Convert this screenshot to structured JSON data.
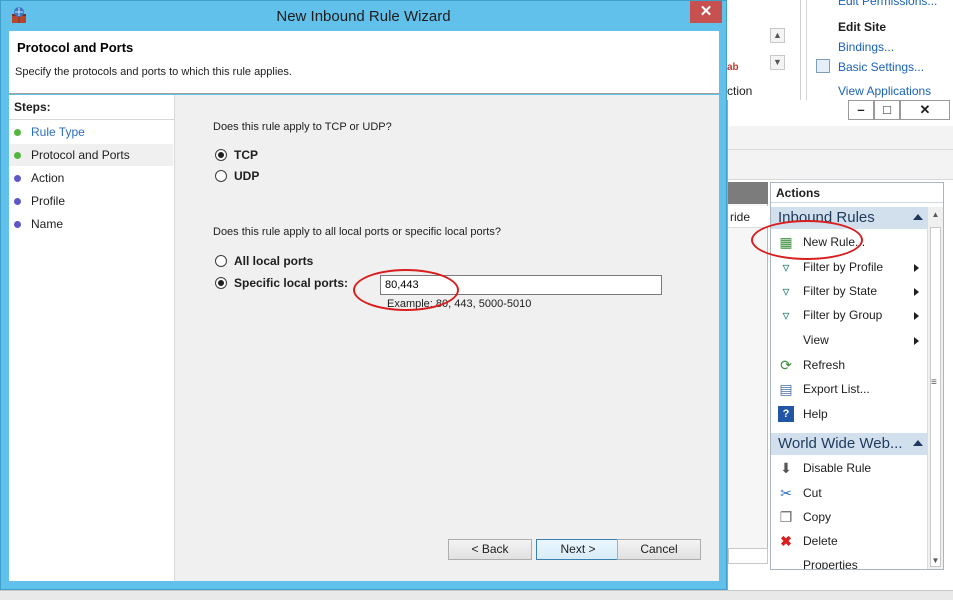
{
  "background": {
    "iis": {
      "links": [
        "Edit Permissions...",
        "Bindings...",
        "Basic Settings...",
        "View Applications"
      ],
      "edit_site_heading": "Edit Site",
      "clipped_texts": [
        "ab",
        "ction"
      ]
    },
    "firewall_console": {
      "window_controls": [
        "–",
        "□",
        "✕"
      ],
      "mid_column_partial": "ride",
      "actions_title": "Actions",
      "sections": [
        {
          "title": "Inbound Rules",
          "items": [
            {
              "label": "New Rule...",
              "icon": "new-rule-icon",
              "submenu": false
            },
            {
              "label": "Filter by Profile",
              "icon": "filter-icon",
              "submenu": true
            },
            {
              "label": "Filter by State",
              "icon": "filter-icon",
              "submenu": true
            },
            {
              "label": "Filter by Group",
              "icon": "filter-icon",
              "submenu": true
            },
            {
              "label": "View",
              "icon": "",
              "submenu": true
            },
            {
              "label": "Refresh",
              "icon": "refresh-icon",
              "submenu": false
            },
            {
              "label": "Export List...",
              "icon": "export-icon",
              "submenu": false
            },
            {
              "label": "Help",
              "icon": "help-icon",
              "submenu": false
            }
          ]
        },
        {
          "title": "World Wide Web...",
          "items": [
            {
              "label": "Disable Rule",
              "icon": "disable-icon",
              "submenu": false
            },
            {
              "label": "Cut",
              "icon": "cut-icon",
              "submenu": false
            },
            {
              "label": "Copy",
              "icon": "copy-icon",
              "submenu": false
            },
            {
              "label": "Delete",
              "icon": "delete-icon",
              "submenu": false
            },
            {
              "label": "Properties",
              "icon": "properties-icon",
              "submenu": false
            }
          ]
        }
      ]
    }
  },
  "wizard": {
    "title": "New Inbound Rule Wizard",
    "close_glyph": "✕",
    "header": {
      "title": "Protocol and Ports",
      "subtitle": "Specify the protocols and ports to which this rule applies."
    },
    "steps_label": "Steps:",
    "steps": [
      {
        "label": "Rule Type",
        "state": "completed-link"
      },
      {
        "label": "Protocol and Ports",
        "state": "current"
      },
      {
        "label": "Action",
        "state": "pending"
      },
      {
        "label": "Profile",
        "state": "pending"
      },
      {
        "label": "Name",
        "state": "pending"
      }
    ],
    "protocol_question": "Does this rule apply to TCP or UDP?",
    "protocol_options": [
      {
        "label": "TCP",
        "selected": true
      },
      {
        "label": "UDP",
        "selected": false
      }
    ],
    "ports_question": "Does this rule apply to all local ports or specific local ports?",
    "ports_options": [
      {
        "label": "All local ports",
        "selected": false
      },
      {
        "label": "Specific local ports:",
        "selected": true
      }
    ],
    "ports_value": "80,443",
    "ports_example": "Example: 80, 443, 5000-5010",
    "buttons": {
      "back": "< Back",
      "next": "Next >",
      "cancel": "Cancel"
    }
  },
  "colors": {
    "title_bar": "#61c1ea",
    "close_button": "#c75050",
    "annotation": "#d81e1e",
    "link": "#2a6ebd",
    "step_done": "#51b73f",
    "step_pending": "#5c59c6"
  }
}
